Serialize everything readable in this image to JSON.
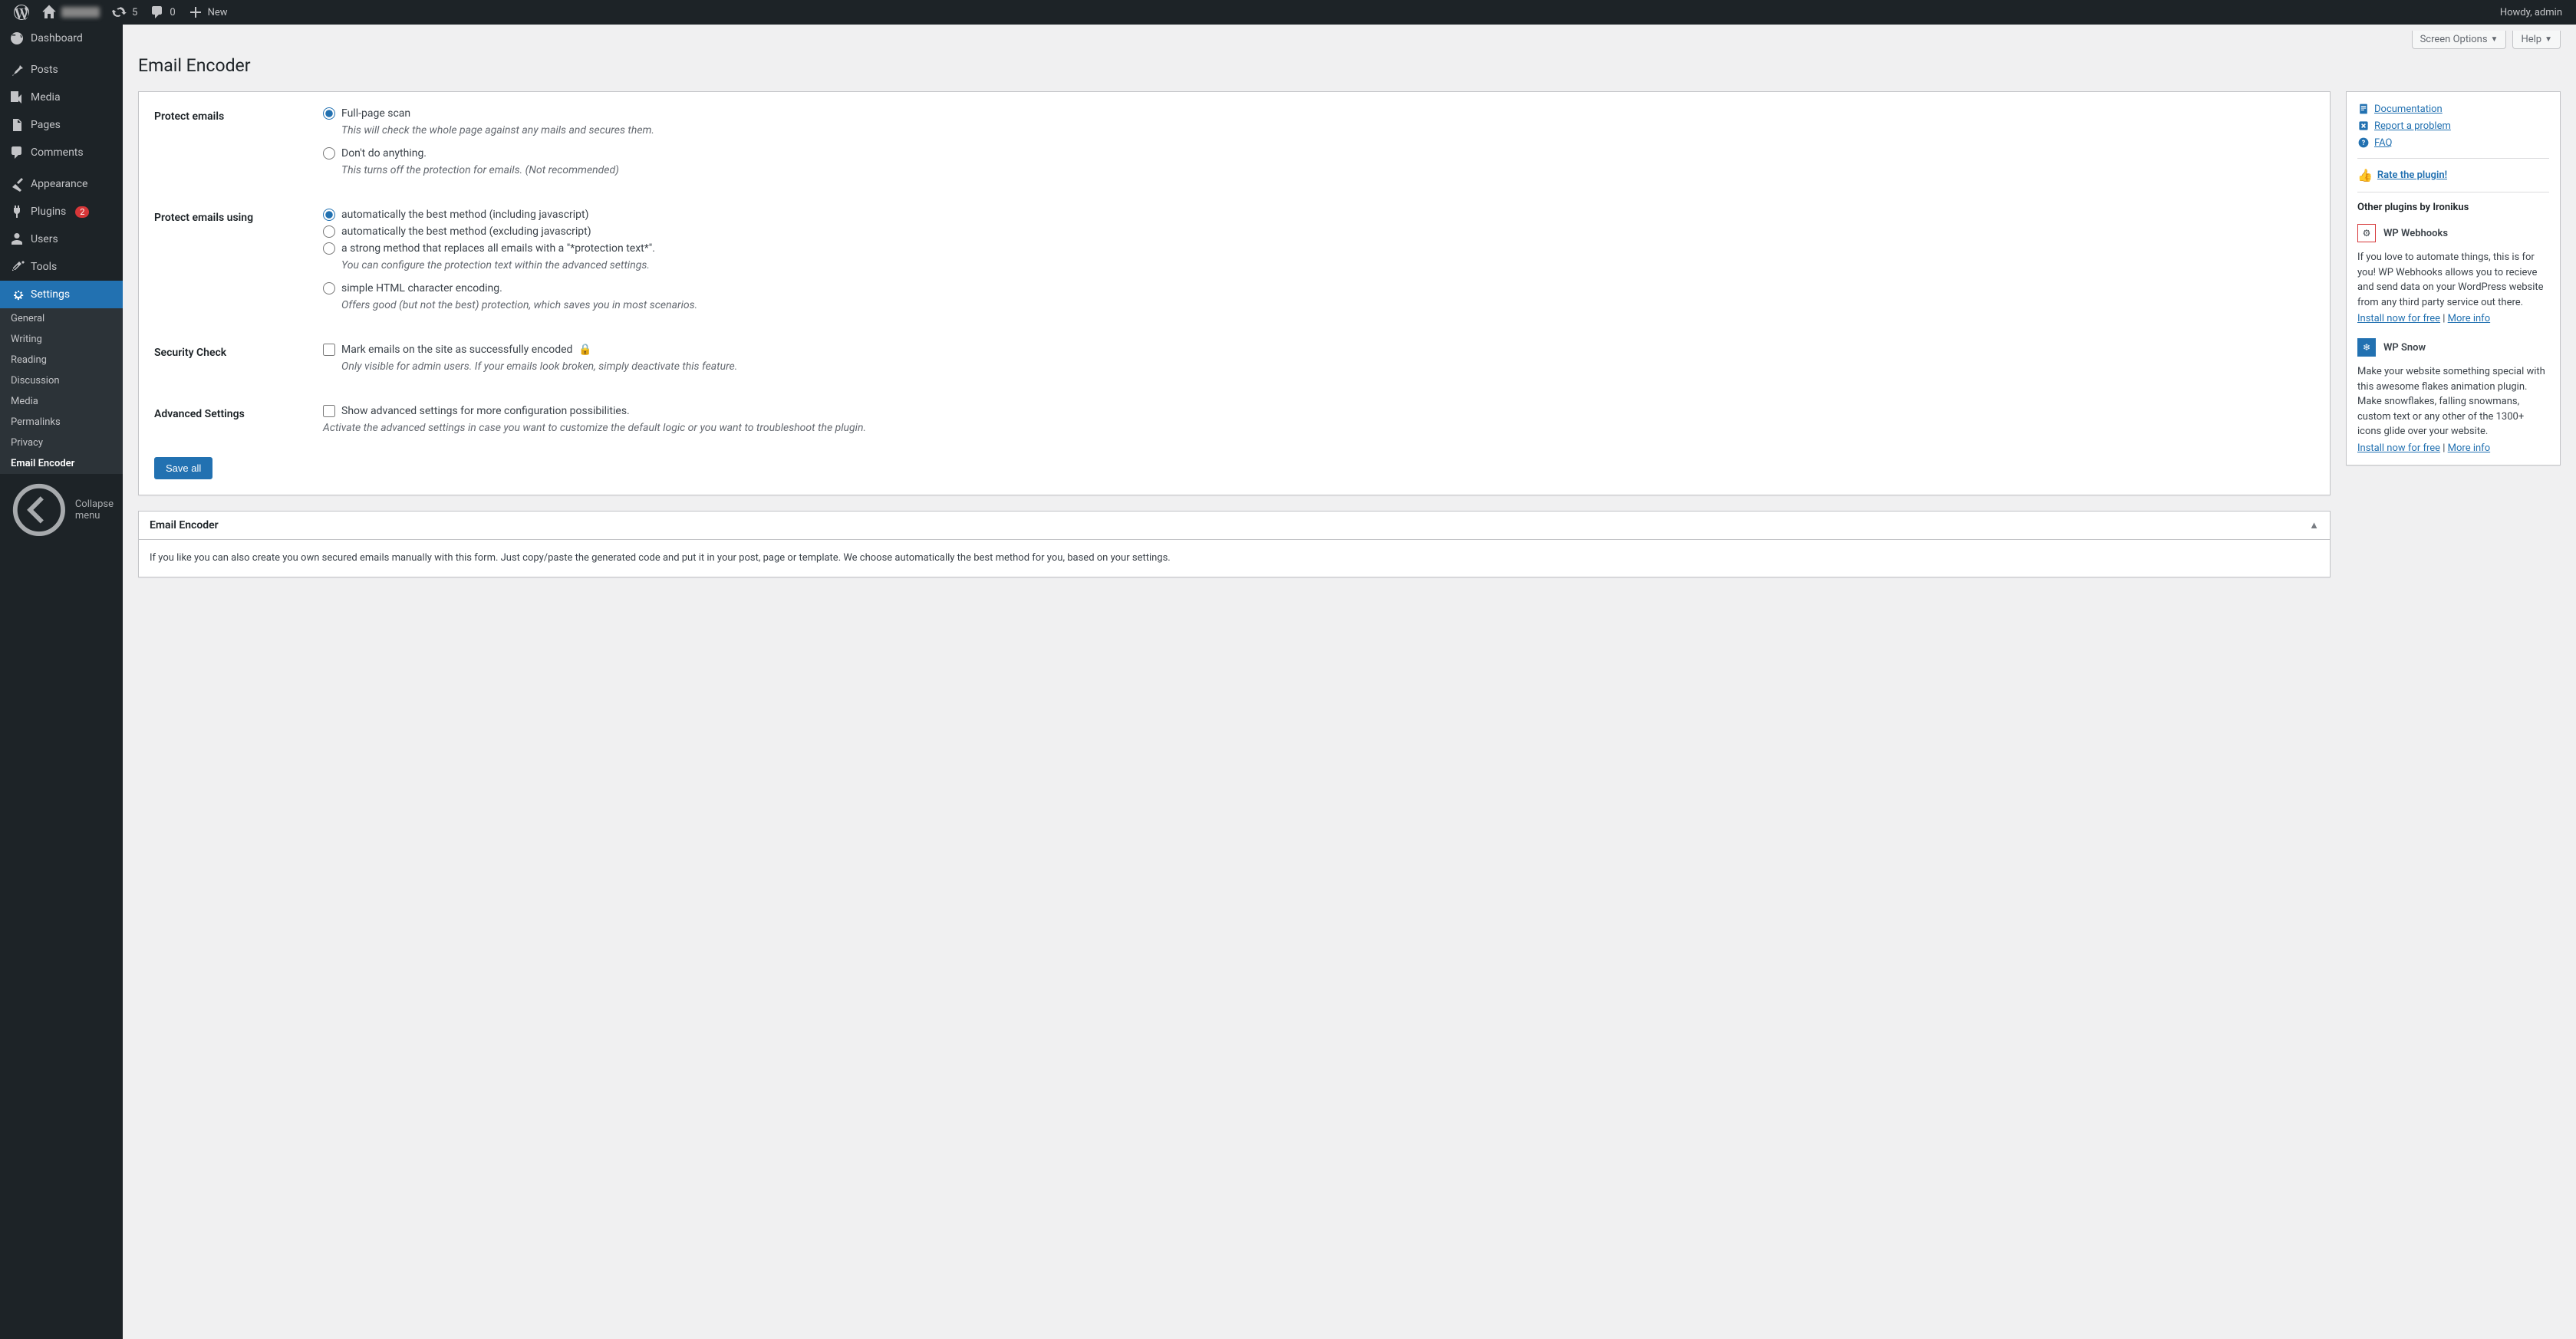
{
  "adminbar": {
    "updates_count": "5",
    "comments_count": "0",
    "new_label": "New",
    "howdy": "Howdy, admin"
  },
  "sidebar": {
    "items": [
      {
        "label": "Dashboard"
      },
      {
        "label": "Posts"
      },
      {
        "label": "Media"
      },
      {
        "label": "Pages"
      },
      {
        "label": "Comments"
      },
      {
        "label": "Appearance"
      },
      {
        "label": "Plugins",
        "badge": "2"
      },
      {
        "label": "Users"
      },
      {
        "label": "Tools"
      },
      {
        "label": "Settings"
      }
    ],
    "submenu": [
      {
        "label": "General"
      },
      {
        "label": "Writing"
      },
      {
        "label": "Reading"
      },
      {
        "label": "Discussion"
      },
      {
        "label": "Media"
      },
      {
        "label": "Permalinks"
      },
      {
        "label": "Privacy"
      },
      {
        "label": "Email Encoder"
      }
    ],
    "collapse": "Collapse menu"
  },
  "top_tabs": {
    "screen_options": "Screen Options",
    "help": "Help"
  },
  "page": {
    "title": "Email Encoder"
  },
  "settings": {
    "protect_emails": {
      "label": "Protect emails",
      "options": [
        {
          "label": "Full-page scan",
          "desc": "This will check the whole page against any mails and secures them.",
          "checked": true
        },
        {
          "label": "Don't do anything.",
          "desc": "This turns off the protection for emails. (Not recommended)",
          "checked": false
        }
      ]
    },
    "protect_using": {
      "label": "Protect emails using",
      "options": [
        {
          "label": "automatically the best method (including javascript)",
          "checked": true
        },
        {
          "label": "automatically the best method (excluding javascript)",
          "checked": false
        },
        {
          "label": "a strong method that replaces all emails with a \"*protection text*\".",
          "desc": "You can configure the protection text within the advanced settings.",
          "checked": false
        },
        {
          "label": "simple HTML character encoding.",
          "desc": "Offers good (but not the best) protection, which saves you in most scenarios.",
          "checked": false
        }
      ]
    },
    "security_check": {
      "label": "Security Check",
      "checkbox_label": "Mark emails on the site as successfully encoded",
      "desc": "Only visible for admin users. If your emails look broken, simply deactivate this feature."
    },
    "advanced": {
      "label": "Advanced Settings",
      "checkbox_label": "Show advanced settings for more configuration possibilities.",
      "desc": "Activate the advanced settings in case you want to customize the default logic or you want to troubleshoot the plugin."
    },
    "save_button": "Save all"
  },
  "postbox": {
    "title": "Email Encoder",
    "text": "If you like you can also create you own secured emails manually with this form. Just copy/paste the generated code and put it in your post, page or template. We choose automatically the best method for you, based on your settings."
  },
  "sidebox": {
    "doc": "Documentation",
    "report": "Report a problem",
    "faq": "FAQ",
    "rate": "Rate the plugin!",
    "other_title": "Other plugins by Ironikus",
    "plugins": [
      {
        "name": "WP Webhooks",
        "desc": "If you love to automate things, this is for you! WP Webhooks allows you to recieve and send data on your WordPress website from any third party service out there.",
        "install": "Install now for free",
        "more": "More info"
      },
      {
        "name": "WP Snow",
        "desc": "Make your website something special with this awesome flakes animation plugin. Make snowflakes, falling snowmans, custom text or any other of the 1300+ icons glide over your website.",
        "install": "Install now for free",
        "more": "More info"
      }
    ]
  }
}
